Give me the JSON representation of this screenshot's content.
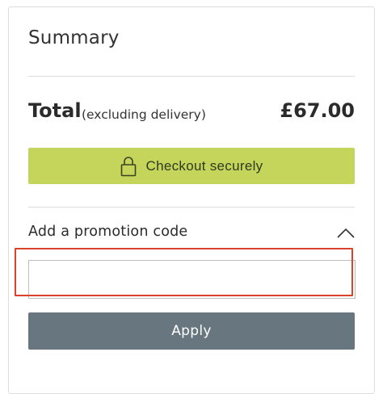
{
  "summary": {
    "title": "Summary",
    "total_label": "Total",
    "total_note": "(excluding delivery)",
    "total_amount": "£67.00"
  },
  "checkout": {
    "label": "Checkout securely",
    "icon": "lock-icon",
    "color": "#c5d45b"
  },
  "promotion": {
    "label": "Add a promotion code",
    "expanded": true,
    "icon": "chevron-up-icon",
    "input_value": "",
    "input_placeholder": "",
    "apply_label": "Apply",
    "apply_color": "#68777f",
    "highlight_color": "#d9432b"
  }
}
